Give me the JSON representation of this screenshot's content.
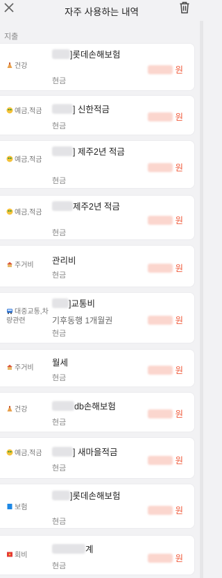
{
  "header": {
    "title": "자주 사용하는 내역"
  },
  "section_label": "지출",
  "items": [
    {
      "category": "건강",
      "memo": "]롯데손해보험",
      "sub": "현금",
      "unit": "원"
    },
    {
      "category": "예금,적금",
      "memo": "] 신한적금",
      "sub": "현금",
      "unit": "원"
    },
    {
      "category": "예금,적금",
      "memo": "] 제주2년 적금",
      "sub": "현금",
      "unit": "원"
    },
    {
      "category": "예금,적금",
      "memo": "제주2년 적금",
      "sub": "현금",
      "unit": "원"
    },
    {
      "category": "주거비",
      "memo": "관리비",
      "sub": "현금",
      "unit": "원"
    },
    {
      "category": "대중교통,차량관련",
      "memo": "]교통비",
      "sub2": "기후동행 1개월권",
      "sub": "현금",
      "unit": "원"
    },
    {
      "category": "주거비",
      "memo": "월세",
      "sub": "현금",
      "unit": "원"
    },
    {
      "category": "건강",
      "memo": "db손해보험",
      "sub": "현금",
      "unit": "원"
    },
    {
      "category": "예금,적금",
      "memo": "] 새마을적금",
      "sub": "현금",
      "unit": "원"
    },
    {
      "category": "보험",
      "memo": "]롯데손해보험",
      "sub": "현금",
      "unit": "원"
    },
    {
      "category": "회비",
      "memo": "계",
      "sub": "현금",
      "unit": "원"
    }
  ],
  "icons": {
    "close": "close-icon",
    "trash": "trash-icon",
    "health": "health-icon",
    "savings": "money-face-icon",
    "housing": "house-icon",
    "transit": "bus-icon",
    "insurance": "book-icon",
    "dues": "red-envelope-icon"
  },
  "colors": {
    "amount": "#f05a3a",
    "background": "#f2f2f4"
  }
}
